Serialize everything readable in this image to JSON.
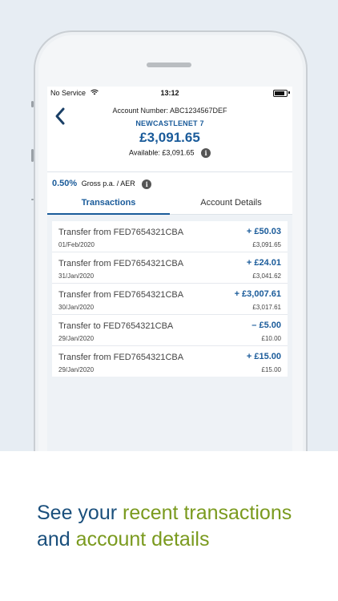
{
  "status_bar": {
    "carrier": "No Service",
    "wifi_icon": "wifi-icon",
    "time": "13:12",
    "battery_icon": "battery-icon"
  },
  "account": {
    "number_label": "Account Number:",
    "number": "ABC1234567DEF",
    "name": "NEWCASTLENET 7",
    "balance": "£3,091.65",
    "available_label": "Available:",
    "available": "£3,091.65"
  },
  "rate": {
    "percent": "0.50%",
    "text": "Gross p.a. / AER"
  },
  "tabs": [
    {
      "label": "Transactions",
      "active": true
    },
    {
      "label": "Account Details",
      "active": false
    }
  ],
  "transactions": [
    {
      "description": "Transfer from FED7654321CBA",
      "date": "01/Feb/2020",
      "amount": "+ £50.03",
      "balance": "£3,091.65"
    },
    {
      "description": "Transfer from FED7654321CBA",
      "date": "31/Jan/2020",
      "amount": "+ £24.01",
      "balance": "£3,041.62"
    },
    {
      "description": "Transfer from FED7654321CBA",
      "date": "30/Jan/2020",
      "amount": "+ £3,007.61",
      "balance": "£3,017.61"
    },
    {
      "description": "Transfer to FED7654321CBA",
      "date": "29/Jan/2020",
      "amount": "– £5.00",
      "balance": "£10.00"
    },
    {
      "description": "Transfer from FED7654321CBA",
      "date": "29/Jan/2020",
      "amount": "+ £15.00",
      "balance": "£15.00"
    }
  ],
  "caption": {
    "part1": "See your ",
    "highlight1": "recent transactions",
    "part2": "and ",
    "highlight2": "account details"
  },
  "colors": {
    "brand_blue": "#1a5b9a",
    "highlight_green": "#7a9a1e",
    "caption_blue": "#1a4f7c"
  }
}
